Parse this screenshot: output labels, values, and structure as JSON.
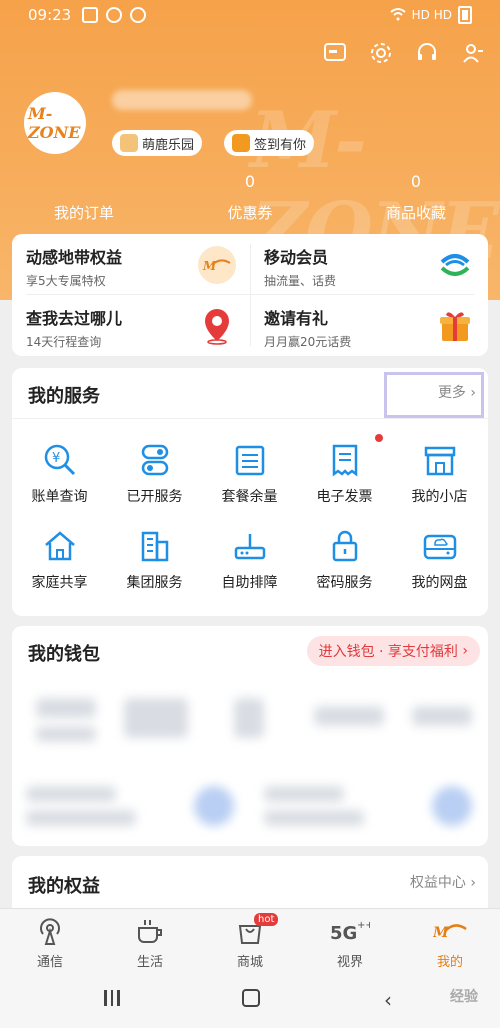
{
  "status_bar": {
    "time": "09:23",
    "signal_labels": "HD  HD"
  },
  "top_icons": [
    "message-icon",
    "settings-icon",
    "headset-icon",
    "user-settings-icon"
  ],
  "hero": {
    "avatar_text": "M-ZONE",
    "watermark_text": "M-ZONE",
    "tags": [
      {
        "label": "萌鹿乐园",
        "icon": "deer-icon"
      },
      {
        "label": "签到有你",
        "icon": "gift-icon"
      }
    ],
    "stats": [
      {
        "value": "",
        "label": "我的订单"
      },
      {
        "value": "0",
        "label": "优惠券"
      },
      {
        "value": "0",
        "label": "商品收藏"
      }
    ]
  },
  "benefits": [
    {
      "title": "动感地带权益",
      "subtitle": "享5大专属特权",
      "icon": "mzone-icon",
      "color": "#f0a03c"
    },
    {
      "title": "移动会员",
      "subtitle": "抽流量、话费",
      "icon": "china-mobile-icon",
      "color": "#1f8fe6"
    },
    {
      "title": "查我去过哪儿",
      "subtitle": "14天行程查询",
      "icon": "location-pin-icon",
      "color": "#e53b3b"
    },
    {
      "title": "邀请有礼",
      "subtitle": "月月赢20元话费",
      "icon": "gift-box-icon",
      "color": "#f29a1f"
    }
  ],
  "services": {
    "title": "我的服务",
    "more": "更多",
    "items": [
      {
        "label": "账单查询",
        "icon": "bill-query-icon"
      },
      {
        "label": "已开服务",
        "icon": "toggle-icon"
      },
      {
        "label": "套餐余量",
        "icon": "package-icon"
      },
      {
        "label": "电子发票",
        "icon": "invoice-icon"
      },
      {
        "label": "我的小店",
        "icon": "shop-icon"
      },
      {
        "label": "家庭共享",
        "icon": "home-icon"
      },
      {
        "label": "集团服务",
        "icon": "building-icon"
      },
      {
        "label": "自助排障",
        "icon": "router-icon"
      },
      {
        "label": "密码服务",
        "icon": "lock-icon"
      },
      {
        "label": "我的网盘",
        "icon": "cloud-disk-icon"
      }
    ]
  },
  "wallet": {
    "title": "我的钱包",
    "button": "进入钱包 · 享支付福利"
  },
  "rights": {
    "title": "我的权益",
    "more": "权益中心"
  },
  "tabs": [
    {
      "label": "通信",
      "icon": "signal-tower-icon",
      "active": false
    },
    {
      "label": "生活",
      "icon": "coffee-cup-icon",
      "active": false
    },
    {
      "label": "商城",
      "icon": "shopping-bag-icon",
      "active": false,
      "badge": "hot"
    },
    {
      "label": "视界",
      "icon": "5g-icon",
      "active": false
    },
    {
      "label": "我的",
      "icon": "mzone-tab-icon",
      "active": true
    }
  ],
  "nav": {
    "watermark": "经验"
  },
  "colors": {
    "accent": "#f6a24a",
    "blue": "#1f8fe6",
    "red": "#e53b3b"
  }
}
